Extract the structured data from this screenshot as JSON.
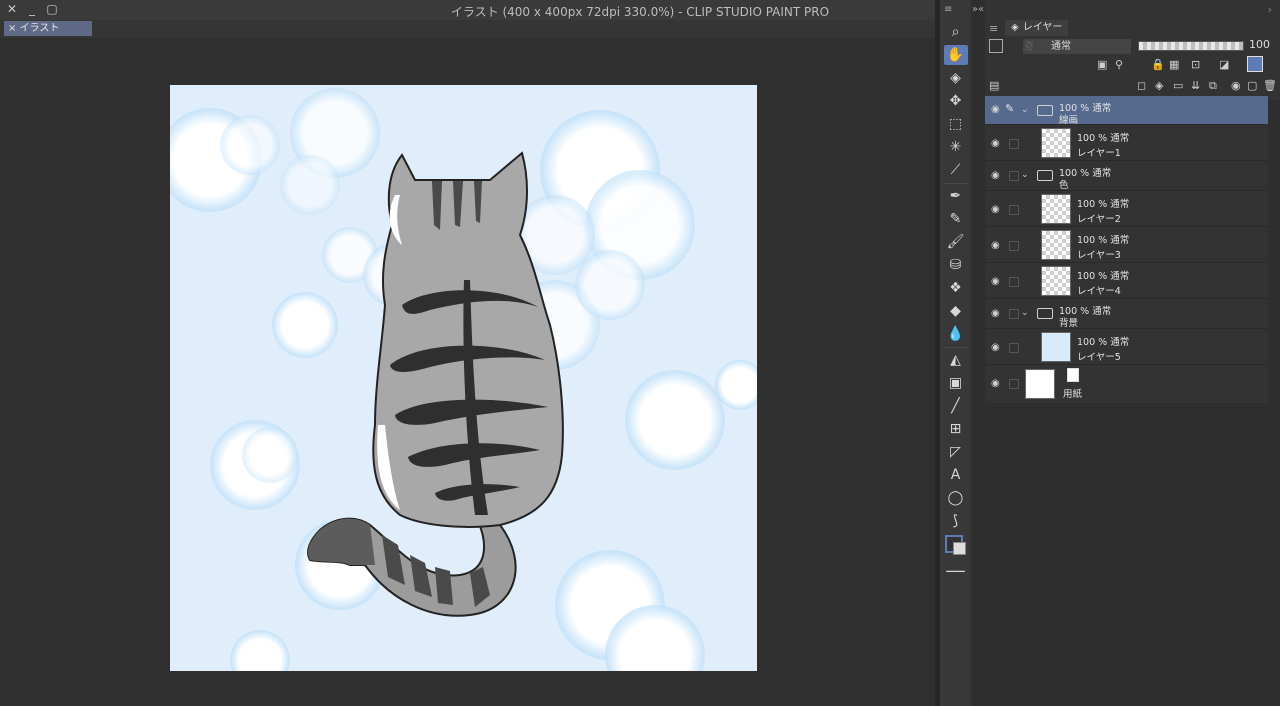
{
  "window": {
    "title": "イラスト (400 x 400px 72dpi 330.0%)  - CLIP STUDIO PAINT PRO",
    "document_tab": "イラスト"
  },
  "layer_panel": {
    "tab_label": "レイヤー",
    "blend_mode": "通常",
    "opacity": "100",
    "layers": [
      {
        "type": "folder",
        "opacity_mode": "100 % 通常",
        "name": "線画",
        "selected": true
      },
      {
        "type": "layer",
        "opacity_mode": "100 % 通常",
        "name": "レイヤー1"
      },
      {
        "type": "folder",
        "opacity_mode": "100 % 通常",
        "name": "色"
      },
      {
        "type": "layer",
        "opacity_mode": "100 % 通常",
        "name": "レイヤー2"
      },
      {
        "type": "layer",
        "opacity_mode": "100 % 通常",
        "name": "レイヤー3"
      },
      {
        "type": "layer",
        "opacity_mode": "100 % 通常",
        "name": "レイヤー4"
      },
      {
        "type": "folder",
        "opacity_mode": "100 % 通常",
        "name": "背景"
      },
      {
        "type": "layer",
        "opacity_mode": "100 % 通常",
        "name": "レイヤー5"
      },
      {
        "type": "paper",
        "name": "用紙"
      }
    ]
  },
  "tools": [
    "zoom-icon",
    "hand-icon",
    "object-select-icon",
    "move-icon",
    "rect-select-icon",
    "magic-wand-icon",
    "eyedropper-icon",
    "pen-icon",
    "pencil-icon",
    "brush-icon",
    "airbrush-icon",
    "decoration-icon",
    "eraser-icon",
    "blend-icon",
    "fill-icon",
    "gradient-icon",
    "line-icon",
    "frame-icon",
    "ruler-icon",
    "text-icon",
    "balloon-icon",
    "correct-line-icon"
  ],
  "colors": {
    "accent": "#5d7bb5",
    "selected_layer": "#566a8e",
    "canvas_bg": "#e0eefc"
  }
}
